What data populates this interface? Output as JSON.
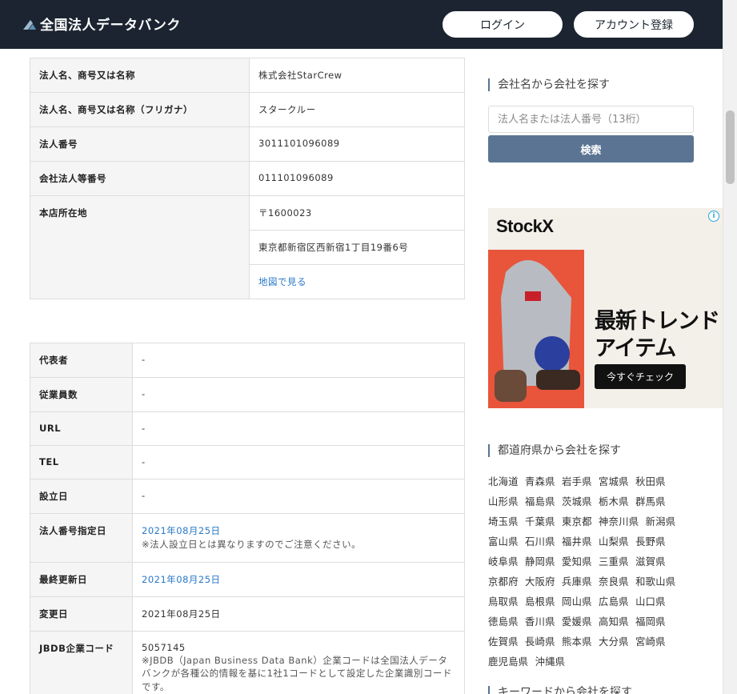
{
  "header": {
    "site_name": "全国法人データバンク",
    "login_label": "ログイン",
    "signup_label": "アカウント登録"
  },
  "basic_info": {
    "rows": [
      {
        "label": "法人名、商号又は名称",
        "value": "株式会社StarCrew"
      },
      {
        "label": "法人名、商号又は名称（フリガナ）",
        "value": "スタークルー"
      },
      {
        "label": "法人番号",
        "value": "3011101096089"
      },
      {
        "label": "会社法人等番号",
        "value": "011101096089"
      }
    ],
    "address_label": "本店所在地",
    "postal": "〒1600023",
    "address": "東京都新宿区西新宿1丁目19番6号",
    "map_link": "地図で見る"
  },
  "detail_info": {
    "representative": {
      "label": "代表者",
      "value": "-"
    },
    "employees": {
      "label": "従業員数",
      "value": "-"
    },
    "url": {
      "label": "URL",
      "value": "-"
    },
    "tel": {
      "label": "TEL",
      "value": "-"
    },
    "established": {
      "label": "設立日",
      "value": "-"
    },
    "designated": {
      "label": "法人番号指定日",
      "value": "2021年08月25日",
      "note": "※法人設立日とは異なりますのでご注意ください。"
    },
    "last_updated": {
      "label": "最終更新日",
      "value": "2021年08月25日"
    },
    "changed": {
      "label": "変更日",
      "value": "2021年08月25日"
    },
    "jbdb": {
      "label": "JBDB企業コード",
      "value": "5057145",
      "note": "※JBDB（Japan Business Data Bank）企業コードは全国法人データバンクが各種公的情報を基に1社1コードとして設定した企業識別コードです。"
    }
  },
  "sidebar": {
    "search_heading": "会社名から会社を探す",
    "search_placeholder": "法人名または法人番号（13桁）",
    "search_button": "検索",
    "pref_heading": "都道府県から会社を探す",
    "prefectures": [
      "北海道",
      "青森県",
      "岩手県",
      "宮城県",
      "秋田県",
      "山形県",
      "福島県",
      "茨城県",
      "栃木県",
      "群馬県",
      "埼玉県",
      "千葉県",
      "東京都",
      "神奈川県",
      "新潟県",
      "富山県",
      "石川県",
      "福井県",
      "山梨県",
      "長野県",
      "岐阜県",
      "静岡県",
      "愛知県",
      "三重県",
      "滋賀県",
      "京都府",
      "大阪府",
      "兵庫県",
      "奈良県",
      "和歌山県",
      "鳥取県",
      "島根県",
      "岡山県",
      "広島県",
      "山口県",
      "徳島県",
      "香川県",
      "愛媛県",
      "高知県",
      "福岡県",
      "佐賀県",
      "長崎県",
      "熊本県",
      "大分県",
      "宮崎県",
      "鹿児島県",
      "沖縄県"
    ],
    "keyword_heading": "キーワードから会社を探す"
  },
  "ad": {
    "brand": "StockX",
    "headline_1": "最新トレンド",
    "headline_2": "アイテム",
    "cta": "今すぐチェック",
    "info_glyph": "i",
    "close_glyph": "✕"
  }
}
